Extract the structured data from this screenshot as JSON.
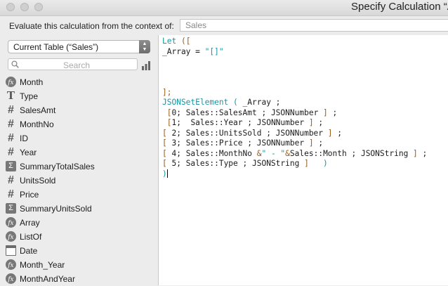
{
  "window": {
    "title": "Specify Calculation “Ar"
  },
  "context": {
    "label": "Evaluate this calculation from the context of:",
    "value": "Sales"
  },
  "table_select": {
    "value": "Current Table (“Sales”)"
  },
  "search": {
    "placeholder": "Search"
  },
  "fields": [
    {
      "icon": "calculation-icon",
      "label": "Month"
    },
    {
      "icon": "text-field-icon",
      "label": "Type"
    },
    {
      "icon": "number-field-icon",
      "label": "SalesAmt"
    },
    {
      "icon": "number-field-icon",
      "label": "MonthNo"
    },
    {
      "icon": "number-field-icon",
      "label": "ID"
    },
    {
      "icon": "number-field-icon",
      "label": "Year"
    },
    {
      "icon": "summary-icon",
      "label": "SummaryTotalSales"
    },
    {
      "icon": "number-field-icon",
      "label": "UnitsSold"
    },
    {
      "icon": "number-field-icon",
      "label": "Price"
    },
    {
      "icon": "summary-icon",
      "label": "SummaryUnitsSold"
    },
    {
      "icon": "calculation-icon",
      "label": "Array"
    },
    {
      "icon": "calculation-icon",
      "label": "ListOf"
    },
    {
      "icon": "date-field-icon",
      "label": "Date"
    },
    {
      "icon": "calculation-icon",
      "label": "Month_Year"
    },
    {
      "icon": "calculation-icon",
      "label": "MonthAndYear"
    }
  ],
  "code_lines": [
    [
      {
        "t": "Let ",
        "c": "k"
      },
      {
        "t": "([",
        "c": "b"
      }
    ],
    [
      {
        "t": "_Array = "
      },
      {
        "t": "\"[]\"",
        "c": "s"
      }
    ],
    [],
    [],
    [],
    [
      {
        "t": "];",
        "c": "b"
      }
    ],
    [
      {
        "t": "JSONSetElement ( ",
        "c": "k"
      },
      {
        "t": "_Array ;"
      }
    ],
    [
      {
        "t": " "
      },
      {
        "t": "[",
        "c": "b"
      },
      {
        "t": "0; Sales::SalesAmt ; JSONNumber "
      },
      {
        "t": "]",
        "c": "b"
      },
      {
        "t": " ;"
      }
    ],
    [
      {
        "t": " "
      },
      {
        "t": "[",
        "c": "b"
      },
      {
        "t": "1;  Sales::Year ; JSONNumber "
      },
      {
        "t": "]",
        "c": "b"
      },
      {
        "t": " ;"
      }
    ],
    [
      {
        "t": "[",
        "c": "b"
      },
      {
        "t": " 2; Sales::UnitsSold ; JSONNumber "
      },
      {
        "t": "]",
        "c": "b"
      },
      {
        "t": " ;"
      }
    ],
    [
      {
        "t": "[",
        "c": "b"
      },
      {
        "t": " 3; Sales::Price ; JSONNumber "
      },
      {
        "t": "]",
        "c": "b"
      },
      {
        "t": " ;"
      }
    ],
    [
      {
        "t": "[",
        "c": "b"
      },
      {
        "t": " 4; Sales::MonthNo "
      },
      {
        "t": "&",
        "c": "b"
      },
      {
        "t": "\" - \"",
        "c": "s"
      },
      {
        "t": "&",
        "c": "b"
      },
      {
        "t": "Sales::Month ; JSONString "
      },
      {
        "t": "]",
        "c": "b"
      },
      {
        "t": " ;"
      }
    ],
    [
      {
        "t": "[",
        "c": "b"
      },
      {
        "t": " 5; Sales::Type ; JSONString "
      },
      {
        "t": "]",
        "c": "b"
      },
      {
        "t": "   "
      },
      {
        "t": ")",
        "c": "k"
      }
    ],
    [
      {
        "t": ")",
        "c": "k"
      }
    ]
  ],
  "colors": {
    "keyword": "#1697a6",
    "bracket": "#9b5a18",
    "string": "#1697a6"
  }
}
